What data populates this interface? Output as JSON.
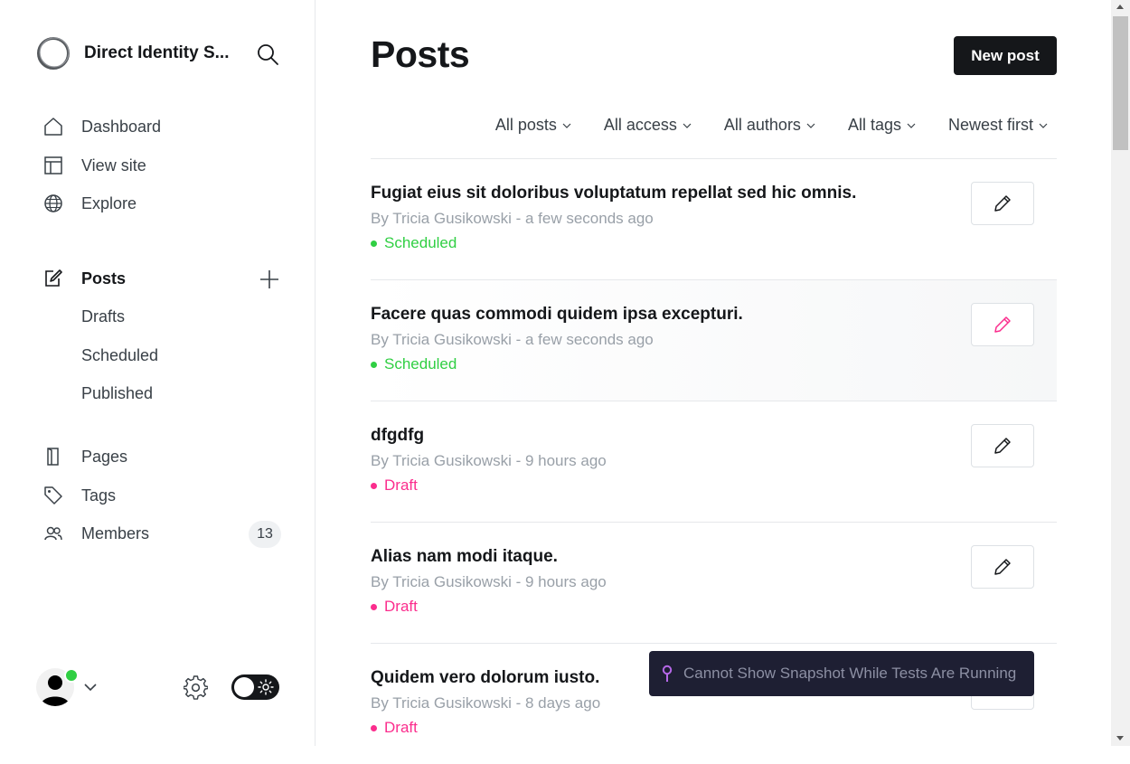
{
  "sidebar": {
    "brand_name": "Direct Identity S...",
    "nav_top": [
      {
        "label": "Dashboard",
        "icon": "home-icon"
      },
      {
        "label": "View site",
        "icon": "layout-icon"
      },
      {
        "label": "Explore",
        "icon": "globe-icon"
      }
    ],
    "posts_label": "Posts",
    "posts_sub": [
      "Drafts",
      "Scheduled",
      "Published"
    ],
    "pages_label": "Pages",
    "tags_label": "Tags",
    "members_label": "Members",
    "members_count": "13"
  },
  "header": {
    "title": "Posts",
    "new_post_label": "New post"
  },
  "filters": [
    "All posts",
    "All access",
    "All authors",
    "All tags",
    "Newest first"
  ],
  "posts": [
    {
      "title": "Fugiat eius sit doloribus voluptatum repellat sed hic omnis.",
      "meta": "By Tricia Gusikowski - a few seconds ago",
      "status": "Scheduled"
    },
    {
      "title": "Facere quas commodi quidem ipsa excepturi.",
      "meta": "By Tricia Gusikowski - a few seconds ago",
      "status": "Scheduled"
    },
    {
      "title": "dfgdfg",
      "meta": "By Tricia Gusikowski - 9 hours ago",
      "status": "Draft"
    },
    {
      "title": "Alias nam modi itaque.",
      "meta": "By Tricia Gusikowski - 9 hours ago",
      "status": "Draft"
    },
    {
      "title": "Quidem vero dolorum iusto.",
      "meta": "By Tricia Gusikowski - 8 days ago",
      "status": "Draft"
    }
  ],
  "toast": {
    "text": "Cannot Show Snapshot While Tests Are Running"
  },
  "colors": {
    "scheduled": "#30cf43",
    "draft": "#fb2d8d",
    "primary_button": "#15171a",
    "online": "#30cf43",
    "toast_bg": "#1e1f33",
    "toast_icon": "#b668e8"
  }
}
